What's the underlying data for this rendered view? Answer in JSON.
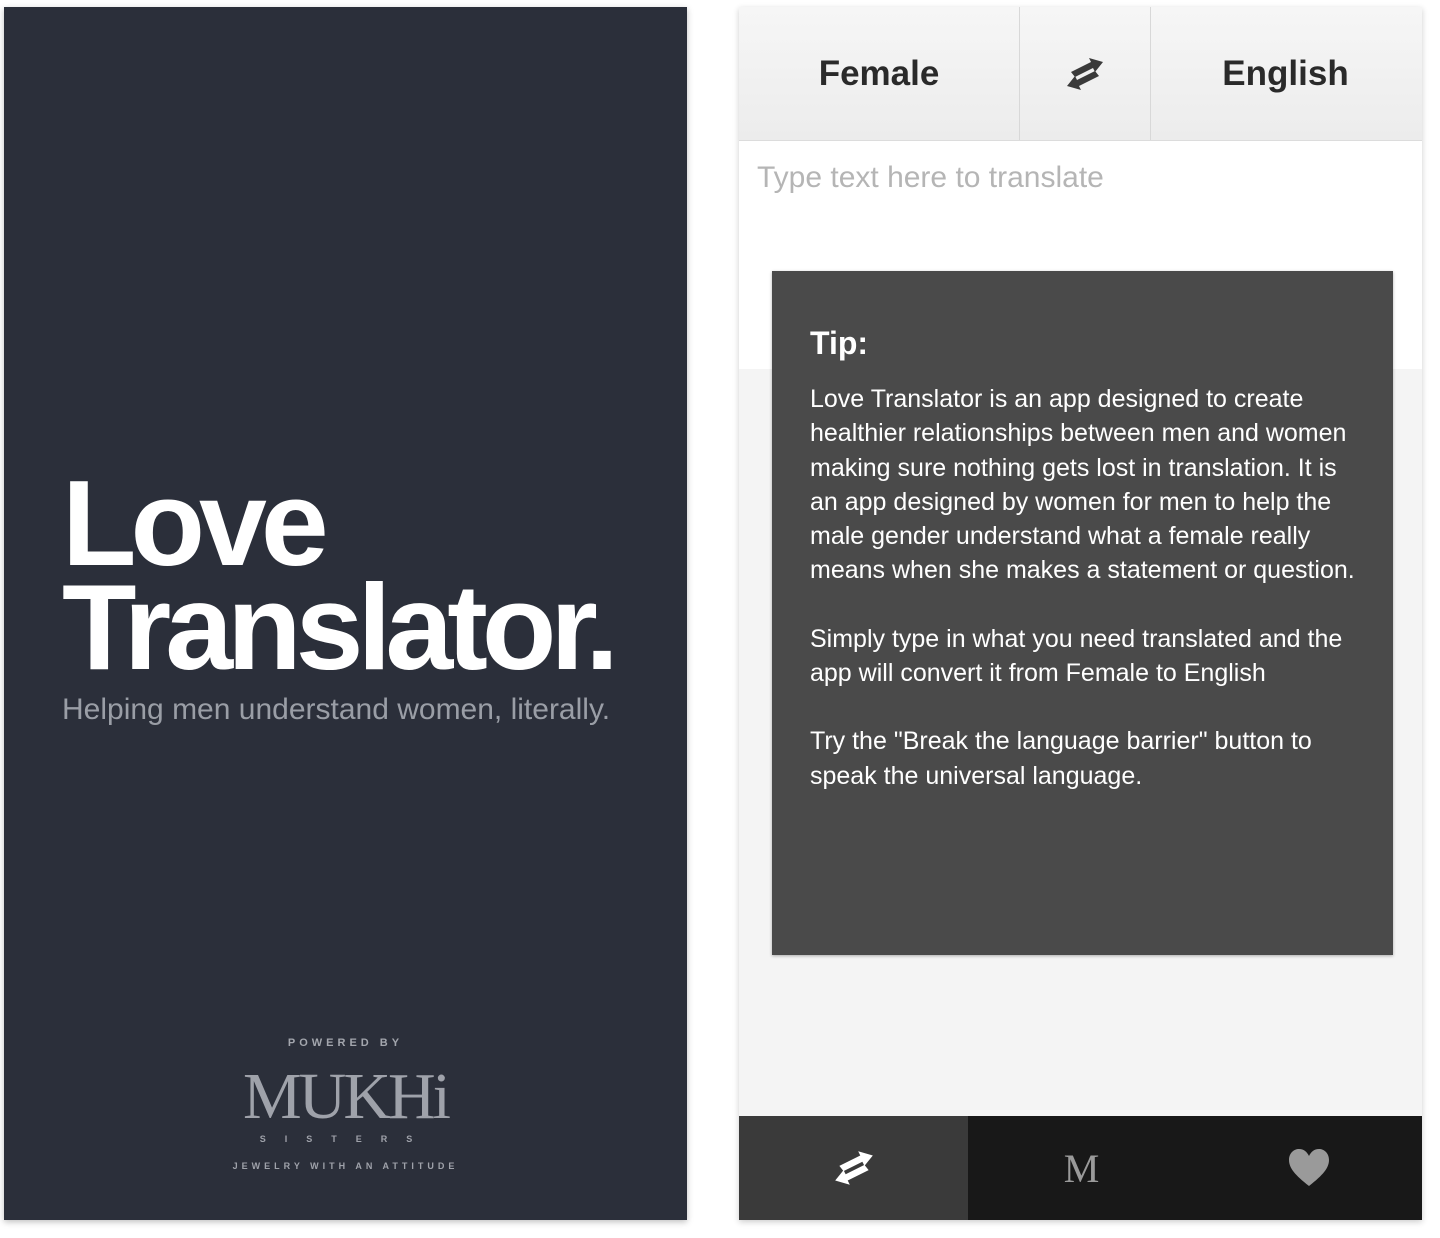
{
  "splash": {
    "title_line1": "Love",
    "title_line2": "Translator.",
    "tagline": "Helping men understand women, literally.",
    "powered_by": "POWERED BY",
    "brand_name": "MUKHi",
    "brand_sub": "SISTERS",
    "brand_slogan": "JEWELRY WITH AN ATTITUDE"
  },
  "translator": {
    "from_language": "Female",
    "to_language": "English",
    "swap_icon": "swap-arrows-icon",
    "input": {
      "value": "",
      "placeholder": "Type text here to translate"
    }
  },
  "tip": {
    "title": "Tip:",
    "paragraphs": [
      "Love Translator is an app designed to create healthier relationships between men and women making sure nothing gets lost in translation. It is an app designed by women for men to help the male gender understand what a female really means when she makes a statement or question.",
      "Simply type in what you need translated and the app will convert it from Female to English",
      "Try the \"Break the language barrier\" button to speak the universal language."
    ]
  },
  "tabbar": {
    "items": [
      {
        "icon": "swap-arrows-icon",
        "active": true
      },
      {
        "label": "M",
        "icon": "mukhi-m-icon",
        "active": false
      },
      {
        "icon": "heart-icon",
        "active": false
      }
    ]
  },
  "colors": {
    "splash_bg": "#2b2f3a",
    "tip_bg": "#4a4a4a",
    "tabbar_bg": "#181818",
    "tab_active_bg": "#3a3a3a"
  }
}
